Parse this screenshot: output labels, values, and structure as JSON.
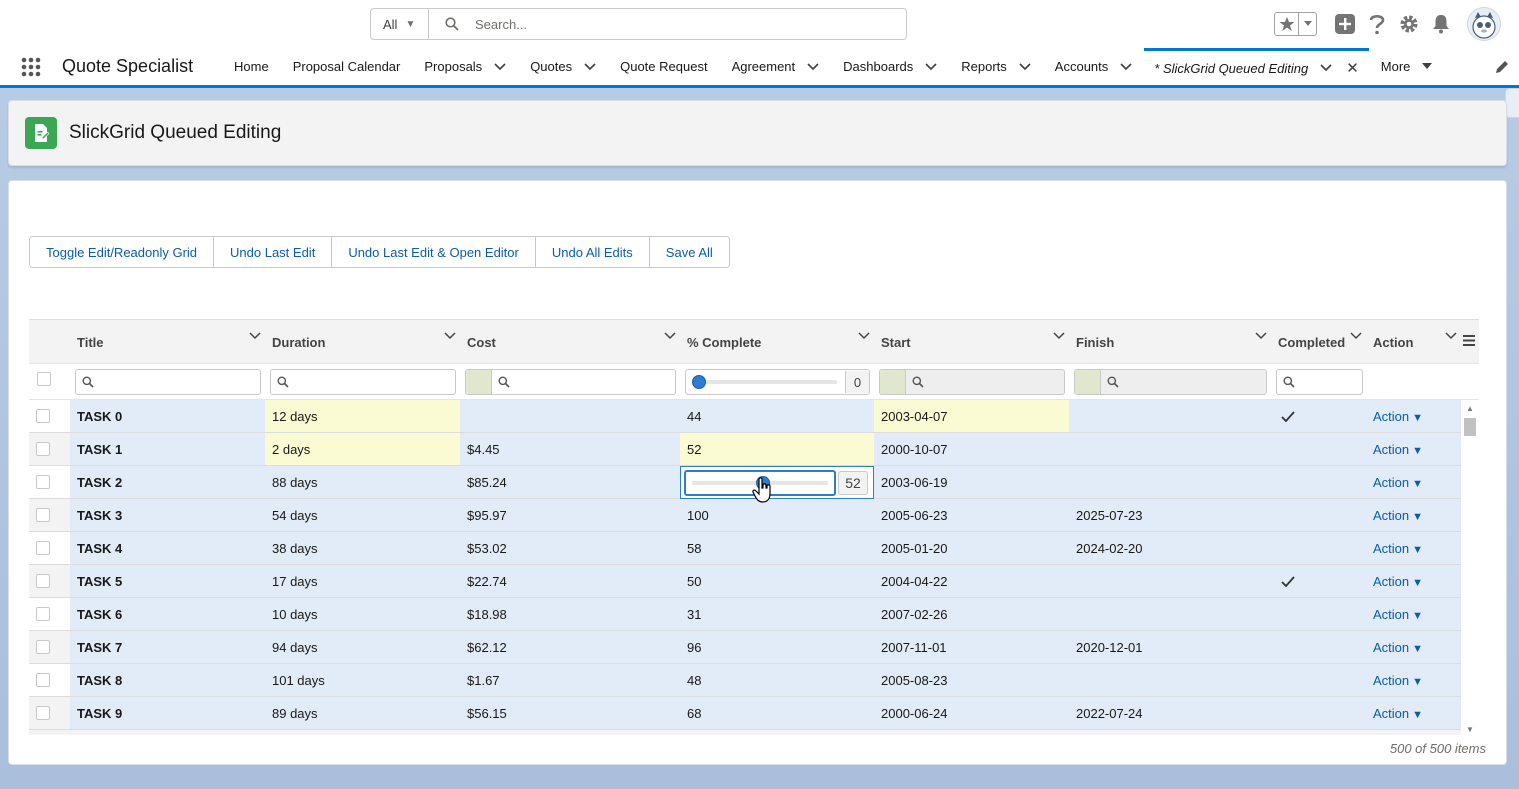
{
  "search": {
    "scope": "All",
    "placeholder": "Search..."
  },
  "header_icons": [
    "favorites-star-icon",
    "add-icon",
    "help-icon",
    "setup-gear-icon",
    "notifications-bell-icon",
    "user-avatar"
  ],
  "app": {
    "name": "Quote Specialist"
  },
  "nav": {
    "items": [
      {
        "label": "Home",
        "dropdown": false
      },
      {
        "label": "Proposal Calendar",
        "dropdown": false
      },
      {
        "label": "Proposals",
        "dropdown": true
      },
      {
        "label": "Quotes",
        "dropdown": true
      },
      {
        "label": "Quote Request",
        "dropdown": false
      },
      {
        "label": "Agreement",
        "dropdown": true
      },
      {
        "label": "Dashboards",
        "dropdown": true
      },
      {
        "label": "Reports",
        "dropdown": true
      },
      {
        "label": "Accounts",
        "dropdown": true
      }
    ],
    "active_tab": "* SlickGrid Queued Editing",
    "more": "More"
  },
  "page": {
    "title": "SlickGrid Queued Editing"
  },
  "toolbar": {
    "buttons": [
      "Toggle Edit/Readonly Grid",
      "Undo Last Edit",
      "Undo Last Edit & Open Editor",
      "Undo All Edits",
      "Save All"
    ]
  },
  "grid": {
    "columns": [
      "Title",
      "Duration",
      "Cost",
      "% Complete",
      "Start",
      "Finish",
      "Completed",
      "Action"
    ],
    "pct_filter_value": "0",
    "rows": [
      {
        "title": "TASK 0",
        "duration": "12 days",
        "cost": "",
        "pct": "44",
        "start": "2003-04-07",
        "finish": "",
        "completed": true,
        "action": "Action"
      },
      {
        "title": "TASK 1",
        "duration": "2 days",
        "cost": "$4.45",
        "pct": "52",
        "start": "2000-10-07",
        "finish": "",
        "completed": false,
        "action": "Action"
      },
      {
        "title": "TASK 2",
        "duration": "88 days",
        "cost": "$85.24",
        "pct": "52",
        "start": "2003-06-19",
        "finish": "",
        "completed": false,
        "action": "Action"
      },
      {
        "title": "TASK 3",
        "duration": "54 days",
        "cost": "$95.97",
        "pct": "100",
        "start": "2005-06-23",
        "finish": "2025-07-23",
        "completed": false,
        "action": "Action"
      },
      {
        "title": "TASK 4",
        "duration": "38 days",
        "cost": "$53.02",
        "pct": "58",
        "start": "2005-01-20",
        "finish": "2024-02-20",
        "completed": false,
        "action": "Action"
      },
      {
        "title": "TASK 5",
        "duration": "17 days",
        "cost": "$22.74",
        "pct": "50",
        "start": "2004-04-22",
        "finish": "",
        "completed": true,
        "action": "Action"
      },
      {
        "title": "TASK 6",
        "duration": "10 days",
        "cost": "$18.98",
        "pct": "31",
        "start": "2007-02-26",
        "finish": "",
        "completed": false,
        "action": "Action"
      },
      {
        "title": "TASK 7",
        "duration": "94 days",
        "cost": "$62.12",
        "pct": "96",
        "start": "2007-11-01",
        "finish": "2020-12-01",
        "completed": false,
        "action": "Action"
      },
      {
        "title": "TASK 8",
        "duration": "101 days",
        "cost": "$1.67",
        "pct": "48",
        "start": "2005-08-23",
        "finish": "",
        "completed": false,
        "action": "Action"
      },
      {
        "title": "TASK 9",
        "duration": "89 days",
        "cost": "$56.15",
        "pct": "68",
        "start": "2000-06-24",
        "finish": "2022-07-24",
        "completed": false,
        "action": "Action"
      }
    ],
    "dirty_cells": [
      [
        0,
        "duration"
      ],
      [
        0,
        "start"
      ],
      [
        1,
        "duration"
      ],
      [
        1,
        "pct"
      ]
    ],
    "editor": {
      "row": 2,
      "value": "52",
      "fraction": 0.52
    },
    "footer": "500 of 500 items"
  },
  "colors": {
    "brand": "#0176d3",
    "link": "#0b5cab",
    "editable": "#e1ecf8",
    "dirty": "#fbfbd3",
    "page_icon": "#3ba755"
  }
}
